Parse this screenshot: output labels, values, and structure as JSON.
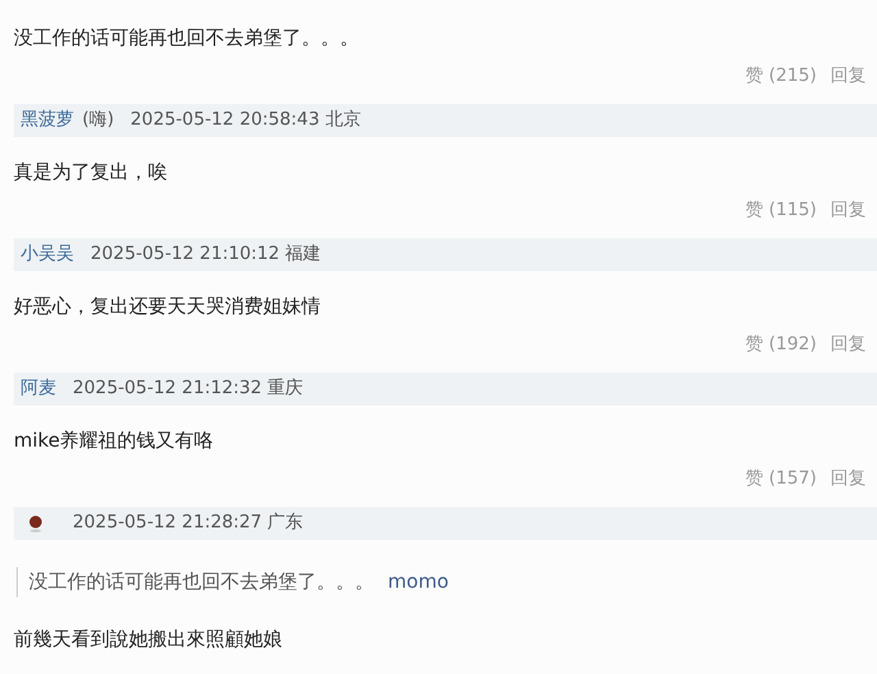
{
  "comments": [
    {
      "text": "没工作的话可能再也回不去弟堡了。。。",
      "likes": "赞 (215)",
      "reply": "回复"
    },
    {
      "author": "黑菠萝",
      "author_note": "(嗨)",
      "time": "2025-05-12 20:58:43",
      "location": "北京",
      "text": "真是为了复出，唉",
      "likes": "赞 (115)",
      "reply": "回复"
    },
    {
      "author": "小吴吴",
      "time": "2025-05-12 21:10:12",
      "location": "福建",
      "text": "好恶心，复出还要天天哭消费姐妹情",
      "likes": "赞 (192)",
      "reply": "回复"
    },
    {
      "author": "阿麦",
      "time": "2025-05-12 21:12:32",
      "location": "重庆",
      "text": "mike养耀祖的钱又有咯",
      "likes": "赞 (157)",
      "reply": "回复"
    },
    {
      "avatar": true,
      "time": "2025-05-12 21:28:27",
      "location": "广东",
      "quote": {
        "text": "没工作的话可能再也回不去弟堡了。。。",
        "author": "momo"
      },
      "text": "前幾天看到說她搬出來照顧她娘"
    }
  ]
}
